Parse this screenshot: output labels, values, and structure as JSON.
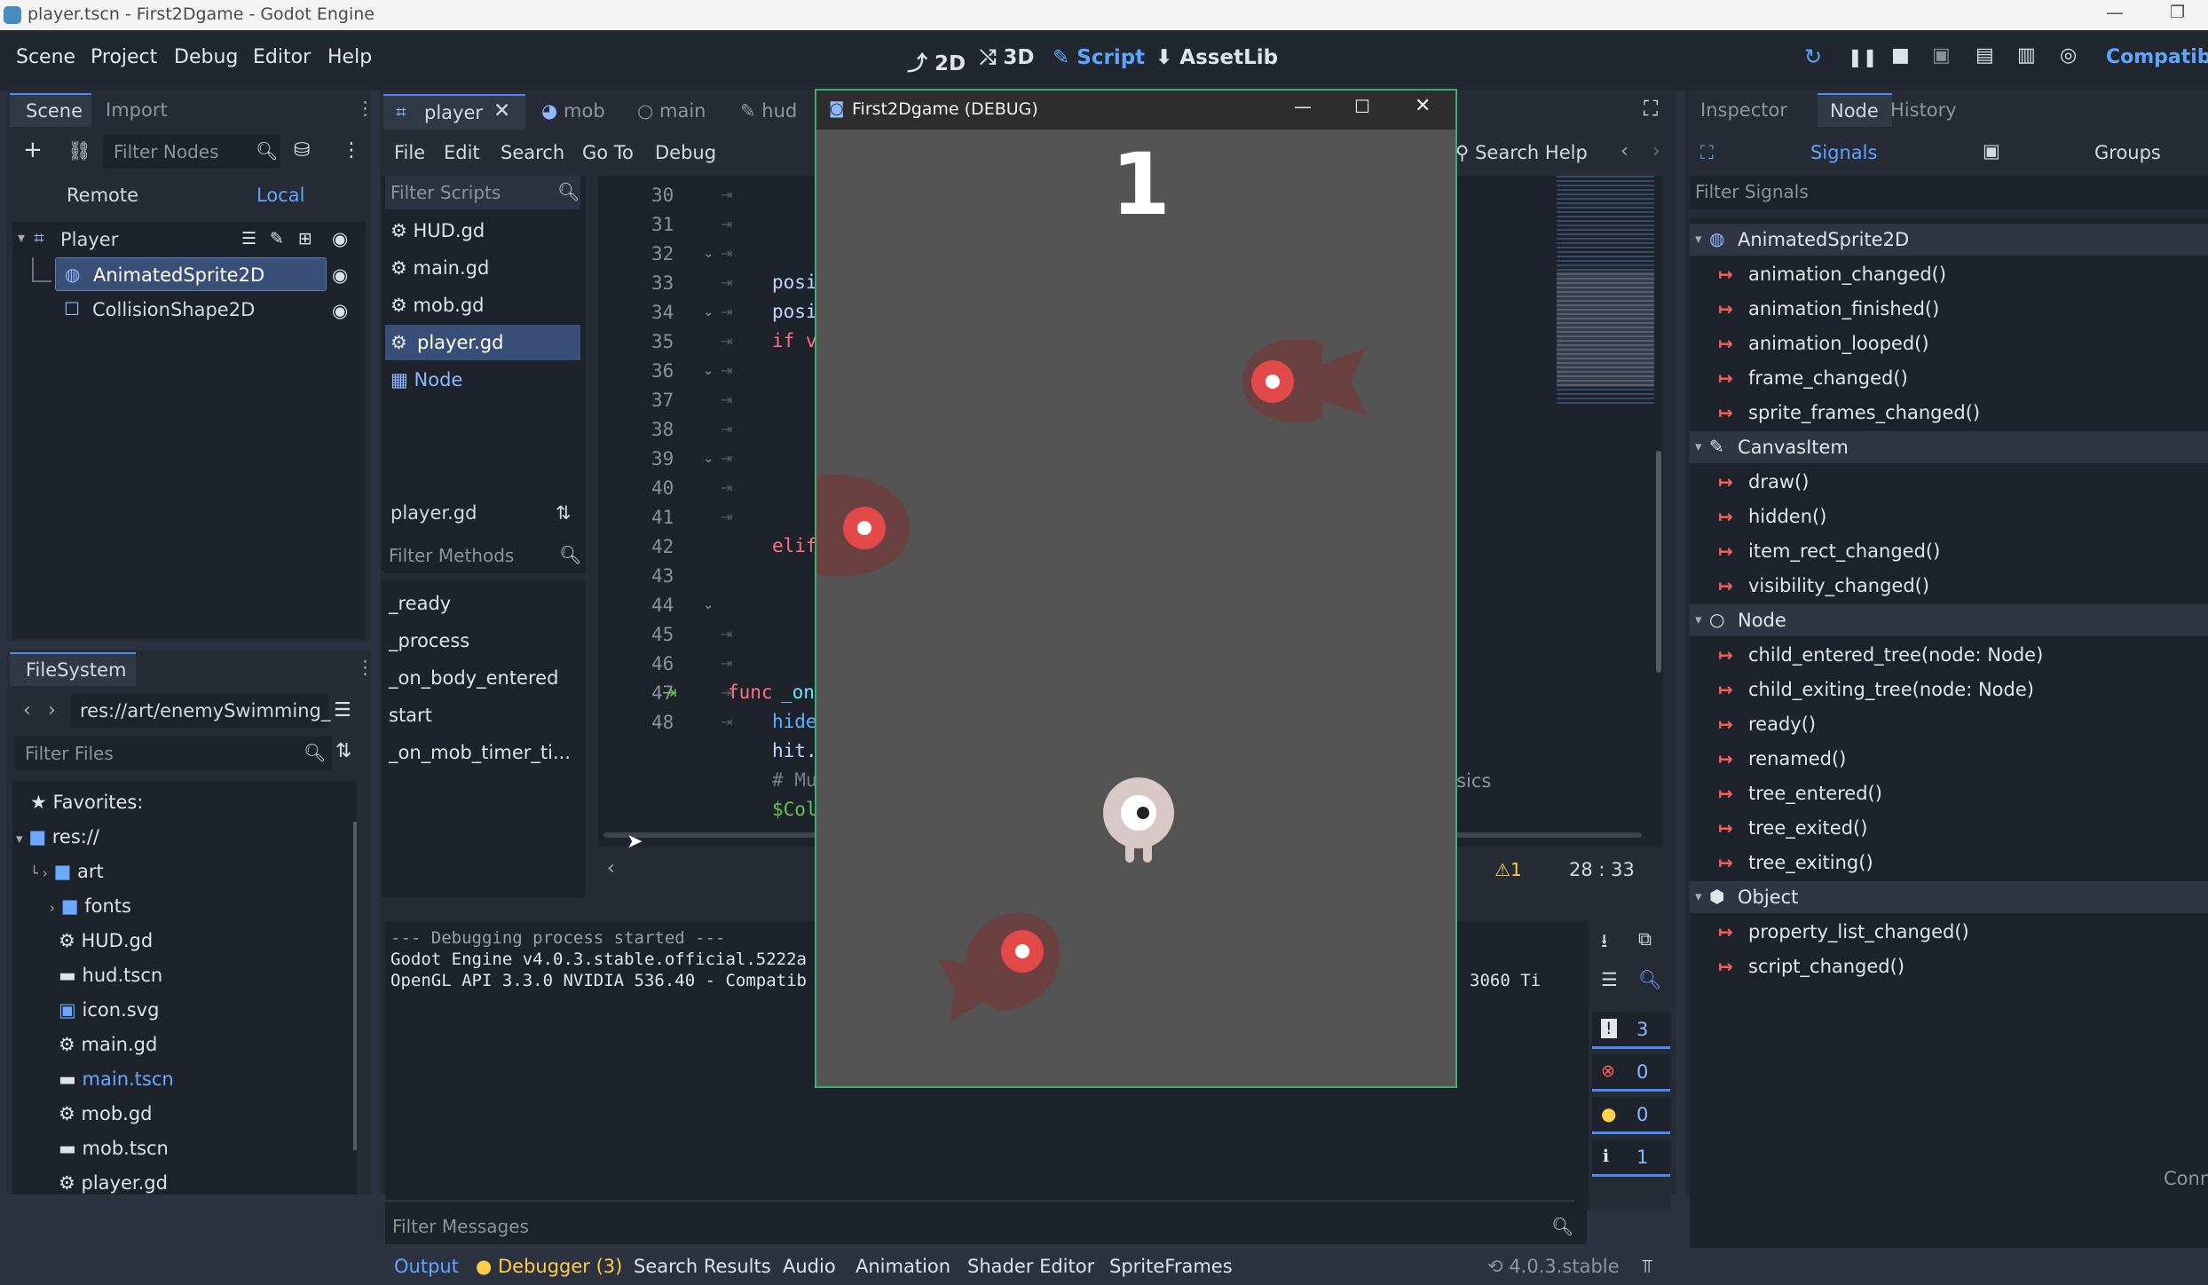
{
  "window": {
    "title": "player.tscn - First2Dgame - Godot Engine"
  },
  "menu": {
    "items": [
      "Scene",
      "Project",
      "Debug",
      "Editor",
      "Help"
    ]
  },
  "modes": {
    "m2d": "2D",
    "m3d": "3D",
    "script": "Script",
    "assetlib": "AssetLib"
  },
  "renderer": "Compatibil",
  "scene_dock": {
    "tabs": {
      "scene": "Scene",
      "import": "Import"
    },
    "filter_placeholder": "Filter Nodes",
    "remote": "Remote",
    "local": "Local",
    "tree": [
      "Player",
      "AnimatedSprite2D",
      "CollisionShape2D"
    ]
  },
  "filesystem": {
    "title": "FileSystem",
    "path": "res://art/enemySwimming_",
    "filter_placeholder": "Filter Files",
    "items": [
      "Favorites:",
      "res://",
      "art",
      "fonts",
      "HUD.gd",
      "hud.tscn",
      "icon.svg",
      "main.gd",
      "main.tscn",
      "mob.gd",
      "mob.tscn",
      "player.gd"
    ]
  },
  "editor_tabs": [
    "player",
    "mob",
    "main",
    "hud"
  ],
  "script_menu": {
    "file": "File",
    "edit": "Edit",
    "search": "Search",
    "goto": "Go To",
    "debug": "Debug",
    "search_help": "Search Help"
  },
  "scripts": {
    "filter_placeholder": "Filter Scripts",
    "list": [
      "HUD.gd",
      "main.gd",
      "mob.gd",
      "player.gd",
      "Node"
    ],
    "current": "player.gd",
    "methods_placeholder": "Filter Methods",
    "methods": [
      "_ready",
      "_process",
      "_on_body_entered",
      "start",
      "_on_mob_timer_ti..."
    ]
  },
  "code": {
    "line_numbers": [
      "30",
      "31",
      "32",
      "33",
      "34",
      "35",
      "36",
      "37",
      "38",
      "39",
      "40",
      "41",
      "42",
      "43",
      "44",
      "45",
      "46",
      "47",
      "48"
    ],
    "lines": {
      "l30": "posi",
      "l31": "posi",
      "l32": "if v",
      "l39": "elif",
      "l44a": "func",
      "l44b": "_on",
      "l45": "hide",
      "l46": "hit.",
      "l47": "# Mu",
      "l48": "$Col"
    },
    "side_text": "physics",
    "warnings": "1",
    "cursor": "28 :   33"
  },
  "output": {
    "lines": [
      "--- Debugging process started ---",
      "Godot Engine v4.0.3.stable.official.5222a",
      "OpenGL API 3.3.0 NVIDIA 536.40 - Compatib"
    ],
    "gpu_suffix": "3060 Ti",
    "filter_placeholder": "Filter Messages",
    "counts": {
      "messages": "3",
      "errors": "0",
      "warnings": "0",
      "info": "1"
    }
  },
  "bottom_tabs": {
    "output": "Output",
    "debugger": "Debugger (3)",
    "search": "Search Results",
    "audio": "Audio",
    "animation": "Animation",
    "shader": "Shader Editor",
    "sprite": "SpriteFrames",
    "version": "4.0.3.stable"
  },
  "inspector": {
    "tabs": {
      "inspector": "Inspector",
      "node": "Node",
      "history": "History"
    },
    "subtabs": {
      "signals": "Signals",
      "groups": "Groups"
    },
    "filter_placeholder": "Filter Signals",
    "groups": [
      {
        "name": "AnimatedSprite2D",
        "signals": [
          "animation_changed()",
          "animation_finished()",
          "animation_looped()",
          "frame_changed()",
          "sprite_frames_changed()"
        ]
      },
      {
        "name": "CanvasItem",
        "signals": [
          "draw()",
          "hidden()",
          "item_rect_changed()",
          "visibility_changed()"
        ]
      },
      {
        "name": "Node",
        "signals": [
          "child_entered_tree(node: Node)",
          "child_exiting_tree(node: Node)",
          "ready()",
          "renamed()",
          "tree_entered()",
          "tree_exited()",
          "tree_exiting()"
        ]
      },
      {
        "name": "Object",
        "signals": [
          "property_list_changed()",
          "script_changed()"
        ]
      }
    ],
    "conn_label": "Conn"
  },
  "game_window": {
    "title": "First2Dgame (DEBUG)",
    "score": "1"
  },
  "colors": {
    "accent": "#4c8bf5",
    "selected": "#3a4f77",
    "signal": "#ff6b6b",
    "game_bg": "#545454",
    "title_bar": "#f3f3f3"
  }
}
